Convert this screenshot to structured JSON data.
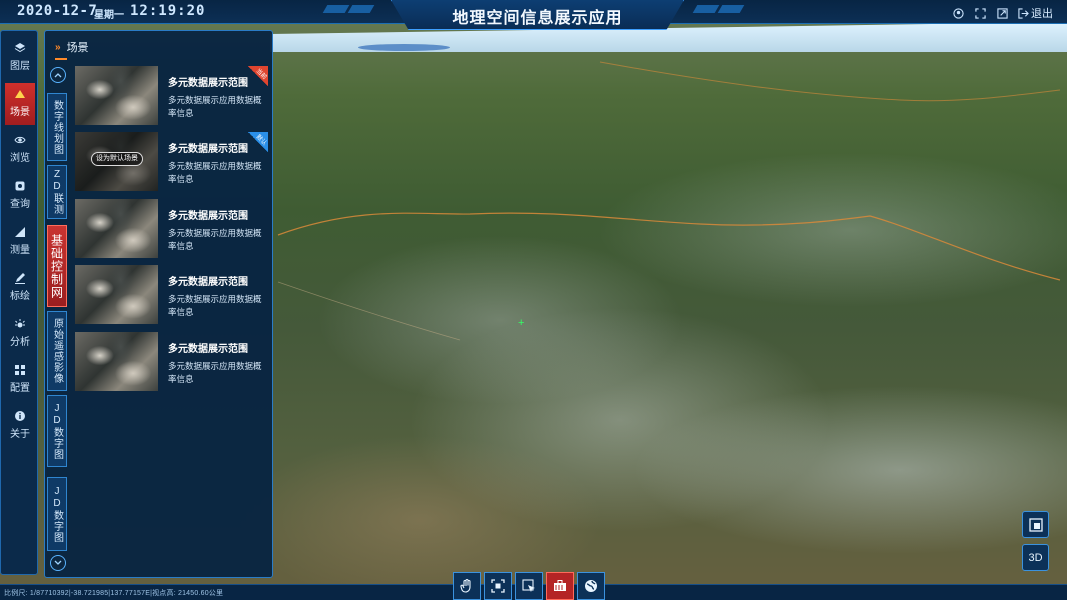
{
  "header": {
    "date": "2020-12-7",
    "weekday": "星期一",
    "time": "12:19:20",
    "title": "地理空间信息展示应用",
    "exit_label": "退出",
    "actions": [
      "user-icon",
      "fullscreen-icon",
      "external-link-icon",
      "exit-icon"
    ]
  },
  "nav": {
    "items": [
      {
        "label": "图层",
        "icon": "layers-icon"
      },
      {
        "label": "场景",
        "icon": "scene-icon",
        "active": true
      },
      {
        "label": "浏览",
        "icon": "eye-icon"
      },
      {
        "label": "查询",
        "icon": "search-icon"
      },
      {
        "label": "测量",
        "icon": "ruler-icon"
      },
      {
        "label": "标绘",
        "icon": "pen-icon"
      },
      {
        "label": "分析",
        "icon": "analysis-icon"
      },
      {
        "label": "配置",
        "icon": "grid-icon"
      },
      {
        "label": "关于",
        "icon": "info-icon"
      }
    ]
  },
  "panel": {
    "title": "场景",
    "tabs": [
      {
        "label": "数字线划图"
      },
      {
        "label": "ZD联测"
      },
      {
        "label": "基础控制网",
        "active": true
      },
      {
        "label": "原始遥感影像"
      },
      {
        "label": "JD数字图"
      },
      {
        "label": "JD数字图"
      }
    ],
    "set_default_label": "设为默认场景",
    "cards": [
      {
        "title": "多元数据展示范围",
        "desc": "多元数据展示应用数据概率信息",
        "ribbon": "red",
        "ribbon_text": "当前"
      },
      {
        "title": "多元数据展示范围",
        "desc": "多元数据展示应用数据概率信息",
        "ribbon": "blue",
        "ribbon_text": "默认"
      },
      {
        "title": "多元数据展示范围",
        "desc": "多元数据展示应用数据概率信息"
      },
      {
        "title": "多元数据展示范围",
        "desc": "多元数据展示应用数据概率信息"
      },
      {
        "title": "多元数据展示范围",
        "desc": "多元数据展示应用数据概率信息"
      }
    ]
  },
  "status": {
    "text": "比例尺: 1/87710392|-38.721985|137.77157E|视点高: 21450.60公里"
  },
  "tools": [
    "pan-hand-icon",
    "frame-select-icon",
    "pointer-select-icon",
    "toolbox-icon",
    "globe-icon"
  ],
  "right_controls": {
    "toggle_icon": "map-toggle-icon",
    "mode_label": "3D"
  },
  "colors": {
    "accent_blue": "#2a7cc6",
    "active_red": "#c93431",
    "orange": "#ff8a2a"
  }
}
